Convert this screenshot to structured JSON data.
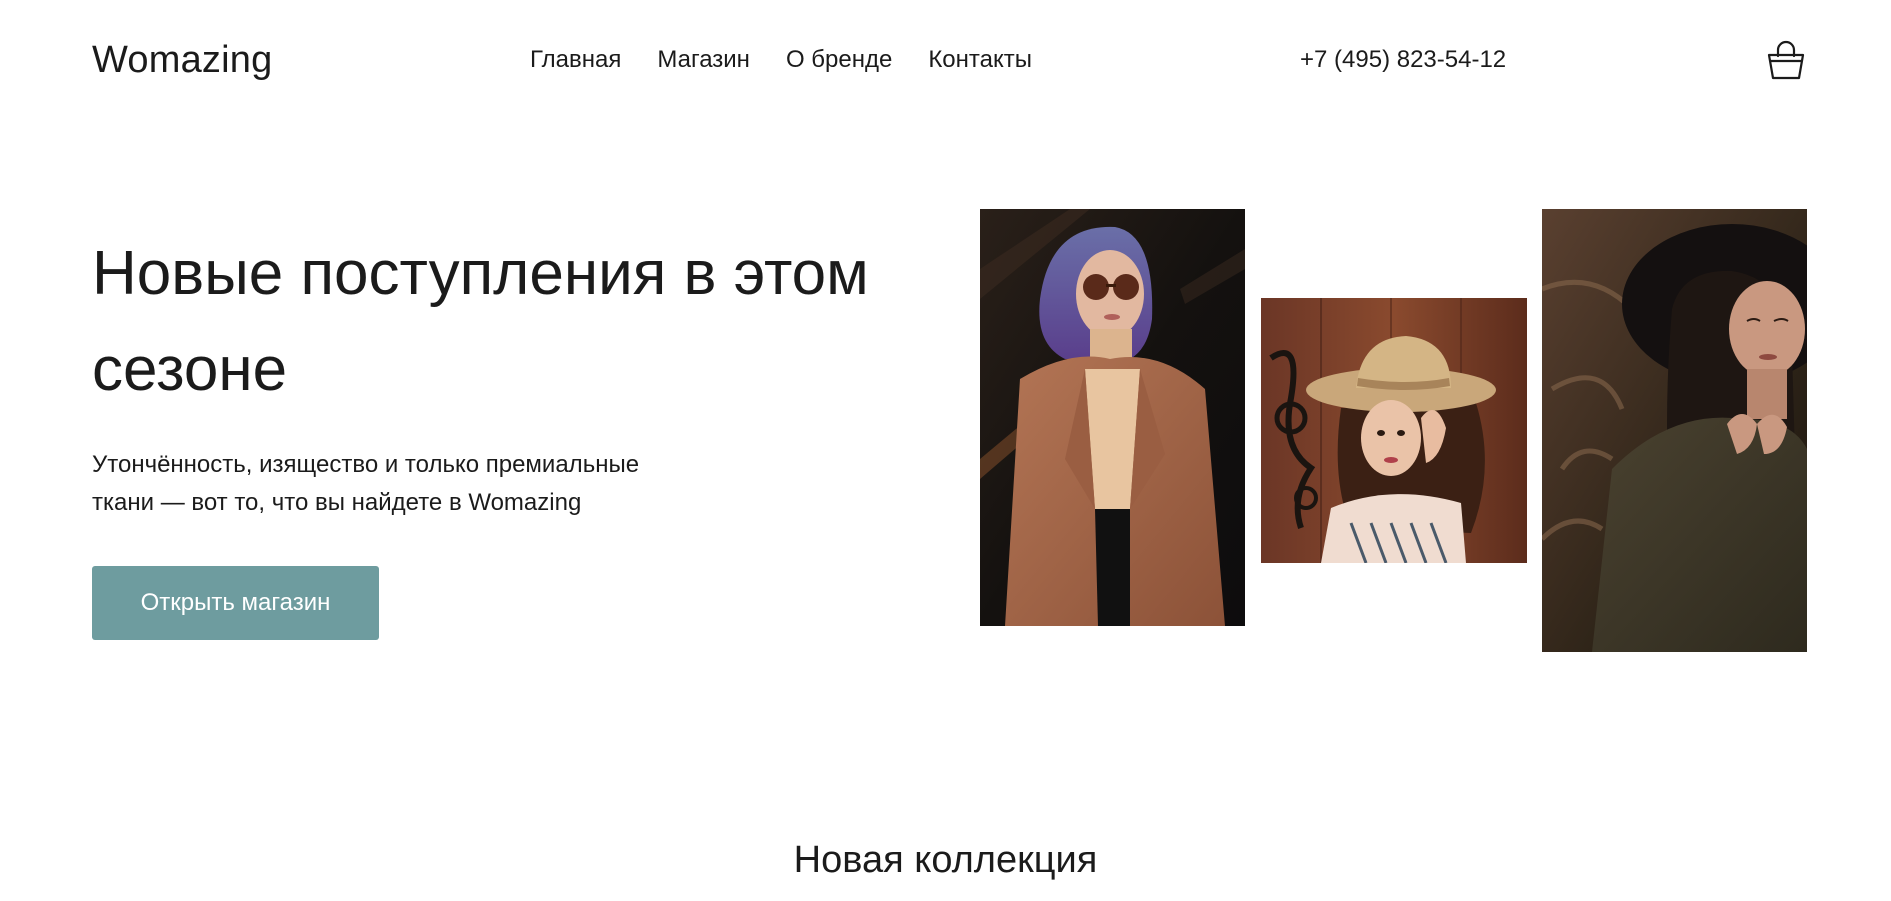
{
  "header": {
    "logo": "Womazing",
    "nav": [
      {
        "label": "Главная"
      },
      {
        "label": "Магазин"
      },
      {
        "label": "О бренде"
      },
      {
        "label": "Контакты"
      }
    ],
    "phone": "+7 (495) 823-54-12",
    "cart_icon": "shopping-bag-icon"
  },
  "hero": {
    "title": "Новые поступления в этом сезоне",
    "description": "Утончённость, изящество и только премиальные ткани — вот то, что вы найдете в Womazing",
    "button_label": "Открыть магазин"
  },
  "section": {
    "title": "Новая коллекция"
  },
  "colors": {
    "accent": "#6e9c9f",
    "text": "#1b1b1b",
    "background": "#ffffff"
  }
}
